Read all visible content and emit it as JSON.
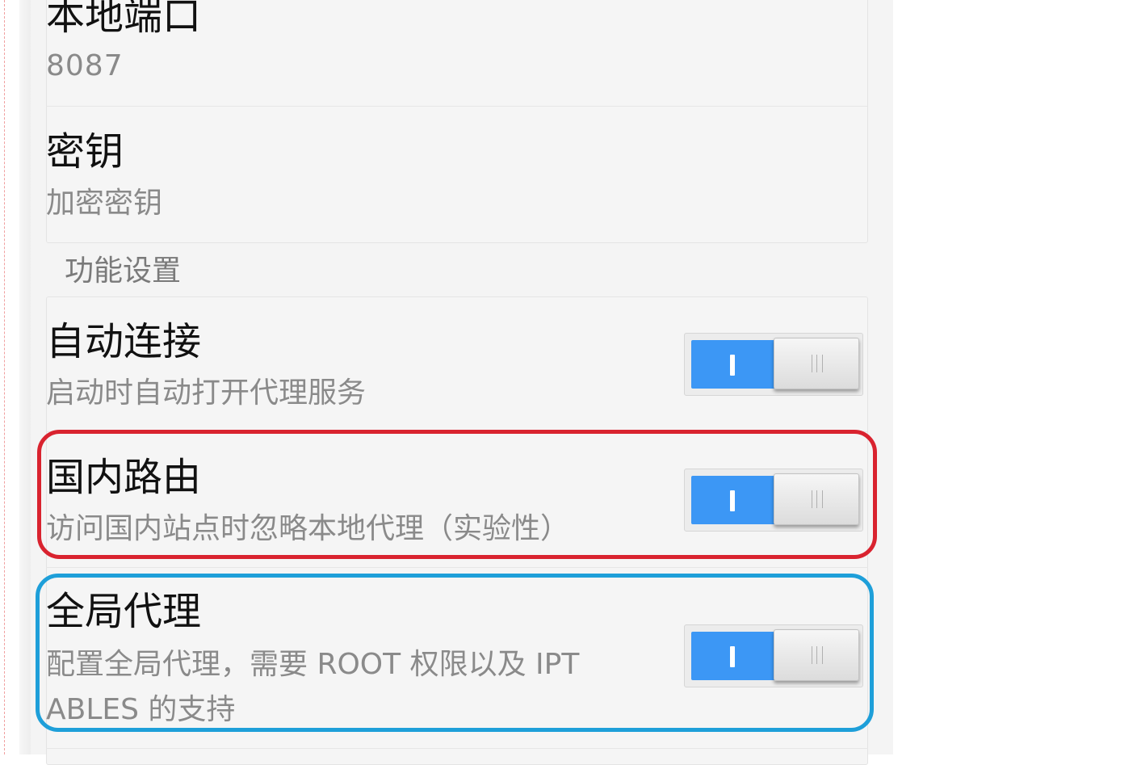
{
  "settings": {
    "local_port": {
      "title": "本地端口",
      "value": "8087"
    },
    "password": {
      "title": "密钥",
      "summary": "加密密钥"
    },
    "feature_section": {
      "header": "功能设置",
      "items": [
        {
          "title": "自动连接",
          "summary": "启动时自动打开代理服务",
          "enabled": true
        },
        {
          "title": "国内路由",
          "summary": "访问国内站点时忽略本地代理（实验性）",
          "enabled": true
        },
        {
          "title": "全局代理",
          "summary_line1": "配置全局代理，需要 ROOT 权限以及 IPT",
          "summary_line2": "ABLES 的支持",
          "enabled": true
        }
      ]
    }
  },
  "colors": {
    "switch_on": "#3c97f5",
    "highlight_red": "#d9232f",
    "highlight_blue": "#1e9fd9"
  }
}
